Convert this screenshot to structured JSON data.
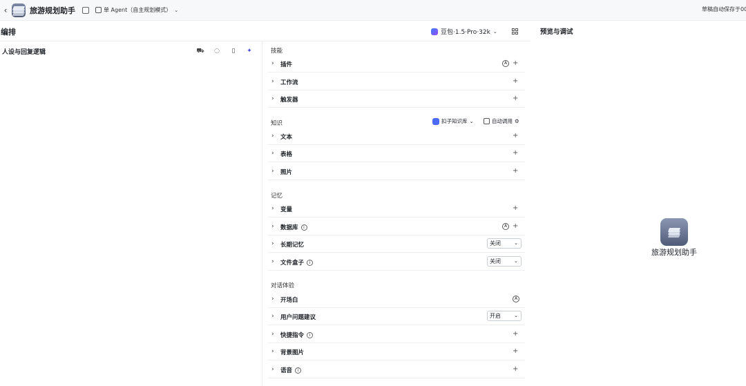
{
  "topbar": {
    "back_glyph": "‹",
    "app_name": "旅游规划助手",
    "agent_mode": "单 Agent（自主规划模式）",
    "save_status": "草稿自动保存于00:"
  },
  "header": {
    "title": "编排",
    "model": "豆包·1.5·Pro·32k"
  },
  "left": {
    "title": "人设与回复逻辑"
  },
  "skills": {
    "title": "技能",
    "items": [
      "插件",
      "工作流",
      "触发器"
    ]
  },
  "knowledge": {
    "title": "知识",
    "kb_label": "扣子知识库",
    "auto_label": "自动调用",
    "items": [
      "文本",
      "表格",
      "照片"
    ]
  },
  "memory": {
    "title": "记忆",
    "items": [
      "变量",
      "数据库",
      "长期记忆",
      "文件盒子"
    ],
    "long_term_value": "关闭",
    "file_box_value": "关闭"
  },
  "dialog": {
    "title": "对话体验",
    "items": [
      "开场白",
      "用户问题建议",
      "快捷指令",
      "背景图片",
      "语音"
    ],
    "suggest_value": "开启"
  },
  "preview": {
    "title": "预览与调试",
    "bot_name": "旅游规划助手"
  },
  "icons": {
    "info": "i",
    "auto_mark": "A",
    "plus": "+",
    "chevron": "›",
    "dropdown": "⌄"
  }
}
